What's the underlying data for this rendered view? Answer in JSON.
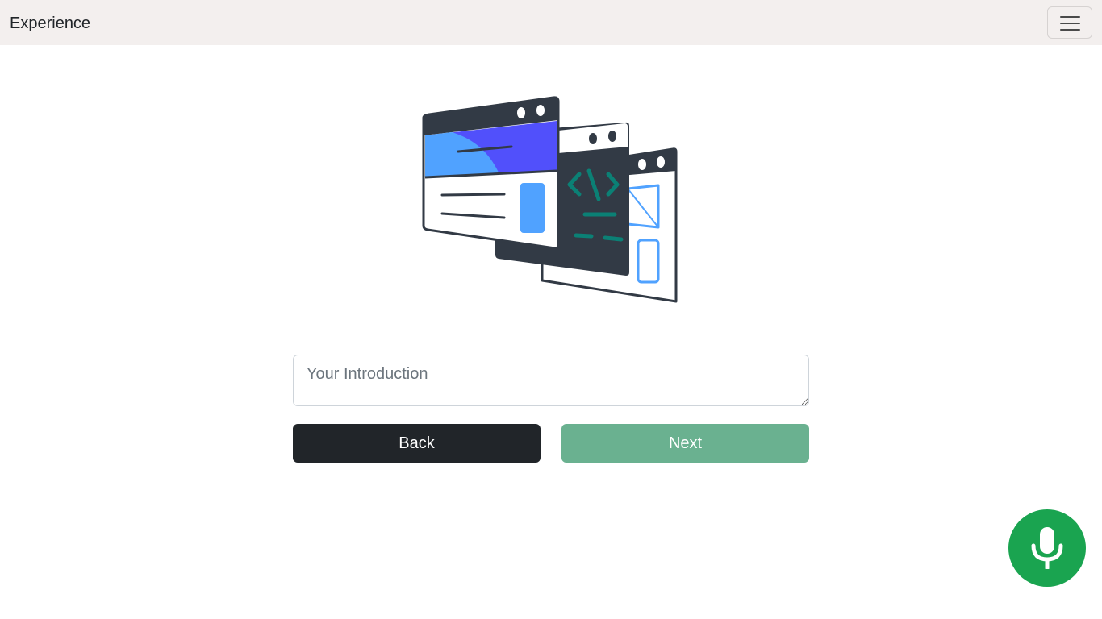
{
  "navbar": {
    "brand": "Experience",
    "menu_icon": "hamburger-icon"
  },
  "hero": {
    "icon": "web-windows-illustration",
    "code_glyph": "<\\>"
  },
  "form": {
    "introduction_placeholder": "Your Introduction",
    "introduction_value": ""
  },
  "buttons": {
    "back_label": "Back",
    "next_label": "Next"
  },
  "voice": {
    "icon": "microphone-icon"
  },
  "colors": {
    "navbar_bg": "#f3efee",
    "back_button": "#212529",
    "next_button": "#6ab190",
    "mic_button": "#1aa450",
    "illustration_dark": "#323a45",
    "illustration_blue": "#50a2ff",
    "illustration_indigo": "#5150fb",
    "illustration_teal": "#0b8075"
  }
}
